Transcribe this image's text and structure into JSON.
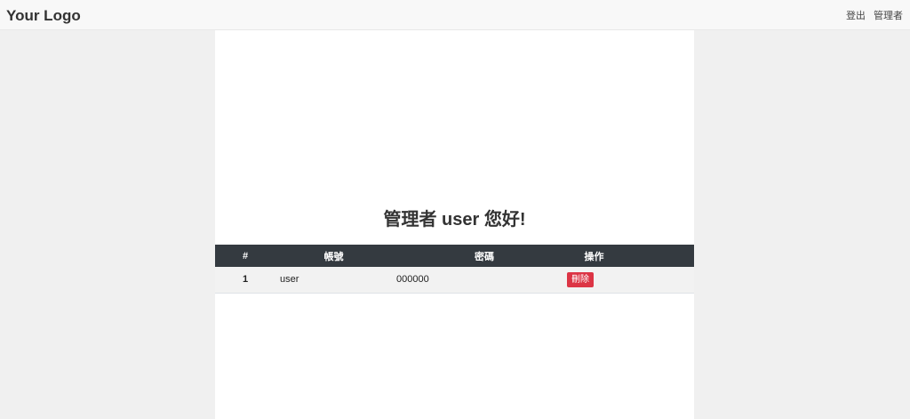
{
  "navbar": {
    "logo": "Your Logo",
    "logout_label": "登出",
    "admin_label": "管理者"
  },
  "main": {
    "greeting": "管理者 user 您好!",
    "table": {
      "headers": [
        "#",
        "帳號",
        "密碼",
        "操作"
      ],
      "rows": [
        {
          "num": "1",
          "account": "user",
          "password": "000000",
          "action": "刪除"
        }
      ]
    }
  },
  "colors": {
    "header_bg": "#343a40",
    "delete_button": "#dc3545",
    "page_bg": "#f0f0f0"
  }
}
